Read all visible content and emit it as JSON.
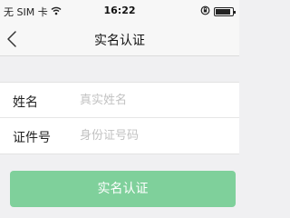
{
  "status_bar": {
    "carrier": "无 SIM 卡",
    "wifi_icon": "wifi-icon",
    "time": "16:22",
    "rotation_lock_icon": "rotation-lock-icon",
    "battery_icon": "battery-icon",
    "battery_level": 0.9
  },
  "nav": {
    "back_icon": "chevron-left-icon",
    "title": "实名认证"
  },
  "form": {
    "fields": [
      {
        "label": "姓名",
        "value": "",
        "placeholder": "真实姓名"
      },
      {
        "label": "证件号",
        "value": "",
        "placeholder": "身份证号码"
      }
    ]
  },
  "submit": {
    "label": "实名认证"
  },
  "colors": {
    "background": "#f0f0f2",
    "bar_background": "#f7f7f7",
    "button": "#7fd09b",
    "placeholder": "#c2c2c2"
  }
}
